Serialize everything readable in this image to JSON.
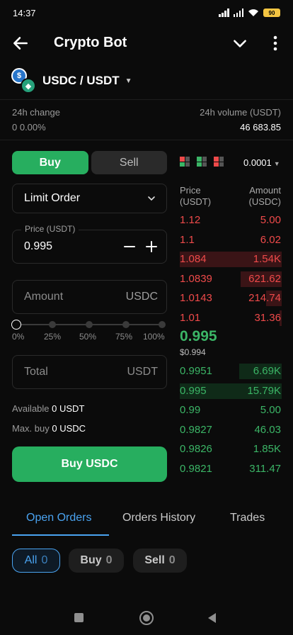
{
  "status": {
    "time": "14:37",
    "battery": "90"
  },
  "header": {
    "title": "Crypto Bot"
  },
  "pair": {
    "label": "USDC / USDT",
    "coin1_glyph": "$",
    "coin2_glyph": "◆"
  },
  "stats": {
    "change_label": "24h change",
    "change_value": "0 0.00%",
    "volume_label": "24h volume (USDT)",
    "volume_value": "46 683.85"
  },
  "trade": {
    "side_buy": "Buy",
    "side_sell": "Sell",
    "order_type": "Limit Order",
    "price_label": "Price (USDT)",
    "price_value": "0.995",
    "amount_placeholder": "Amount",
    "amount_unit": "USDC",
    "slider_labels": [
      "0%",
      "25%",
      "50%",
      "75%",
      "100%"
    ],
    "slider_value": 0,
    "total_placeholder": "Total",
    "total_unit": "USDT",
    "available_label": "Available",
    "available_value": "0 USDT",
    "maxbuy_label": "Max. buy",
    "maxbuy_value": "0 USDC",
    "submit_label": "Buy USDC"
  },
  "orderbook": {
    "precision": "0.0001",
    "price_header_1": "Price",
    "price_header_2": "(USDT)",
    "amount_header_1": "Amount",
    "amount_header_2": "(USDC)",
    "asks": [
      {
        "price": "1.12",
        "amount": "5.00",
        "depth": 0
      },
      {
        "price": "1.1",
        "amount": "6.02",
        "depth": 0
      },
      {
        "price": "1.084",
        "amount": "1.54K",
        "depth": 1.0
      },
      {
        "price": "1.0839",
        "amount": "621.62",
        "depth": 0.4
      },
      {
        "price": "1.0143",
        "amount": "214.74",
        "depth": 0.15
      },
      {
        "price": "1.01",
        "amount": "31.36",
        "depth": 0.02
      }
    ],
    "mid_price": "0.995",
    "mid_usd": "$0.994",
    "bids": [
      {
        "price": "0.9951",
        "amount": "6.69K",
        "depth": 0.42
      },
      {
        "price": "0.995",
        "amount": "15.79K",
        "depth": 1.0
      },
      {
        "price": "0.99",
        "amount": "5.00",
        "depth": 0
      },
      {
        "price": "0.9827",
        "amount": "46.03",
        "depth": 0
      },
      {
        "price": "0.9826",
        "amount": "1.85K",
        "depth": 0
      },
      {
        "price": "0.9821",
        "amount": "311.47",
        "depth": 0
      }
    ]
  },
  "tabs": [
    {
      "label": "Open Orders",
      "active": true
    },
    {
      "label": "Orders History",
      "active": false
    },
    {
      "label": "Trades",
      "active": false
    }
  ],
  "filters": [
    {
      "label": "All",
      "count": "0",
      "active": true
    },
    {
      "label": "Buy",
      "count": "0",
      "active": false
    },
    {
      "label": "Sell",
      "count": "0",
      "active": false
    }
  ],
  "colors": {
    "buy": "#27ae5f",
    "ask": "#ef4a4a",
    "bid": "#3bb566",
    "accent": "#4aa3f0"
  }
}
